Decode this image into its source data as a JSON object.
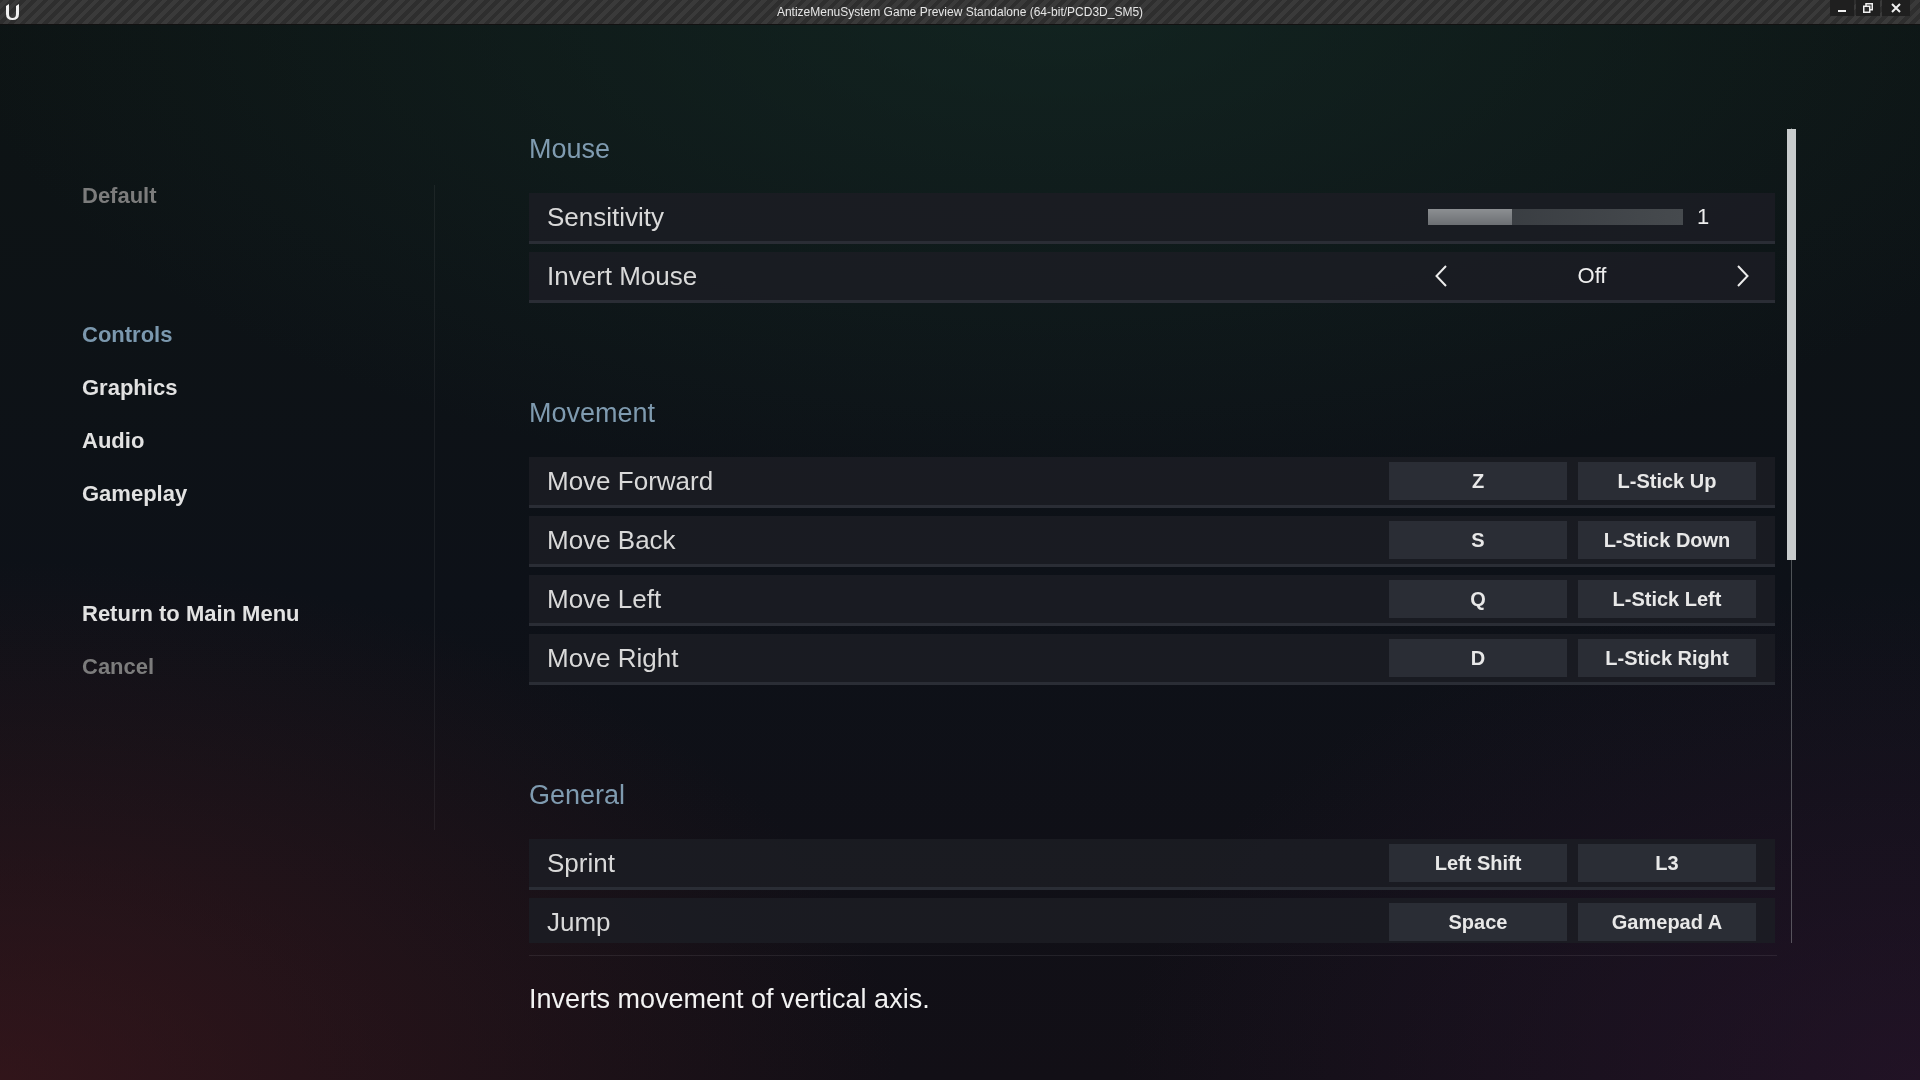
{
  "window": {
    "title": "AntizeMenuSystem Game Preview Standalone (64-bit/PCD3D_SM5)"
  },
  "sidebar": {
    "top_items": [
      {
        "label": "Default",
        "disabled": true
      }
    ],
    "tabs": [
      {
        "label": "Controls",
        "selected": true
      },
      {
        "label": "Graphics",
        "selected": false
      },
      {
        "label": "Audio",
        "selected": false
      },
      {
        "label": "Gameplay",
        "selected": false
      }
    ],
    "actions": [
      {
        "label": "Return to Main Menu",
        "disabled": false
      },
      {
        "label": "Cancel",
        "disabled": true
      }
    ]
  },
  "sections": [
    {
      "title": "Mouse",
      "rows": [
        {
          "kind": "slider",
          "label": "Sensitivity",
          "level": 0.33,
          "reading": "1"
        },
        {
          "kind": "selector",
          "label": "Invert Mouse",
          "value": "Off"
        }
      ]
    },
    {
      "title": "Movement",
      "rows": [
        {
          "kind": "binding",
          "label": "Move Forward",
          "keys": [
            "Z",
            "L-Stick Up"
          ]
        },
        {
          "kind": "binding",
          "label": "Move Back",
          "keys": [
            "S",
            "L-Stick Down"
          ]
        },
        {
          "kind": "binding",
          "label": "Move Left",
          "keys": [
            "Q",
            "L-Stick Left"
          ]
        },
        {
          "kind": "binding",
          "label": "Move Right",
          "keys": [
            "D",
            "L-Stick Right"
          ]
        }
      ]
    },
    {
      "title": "General",
      "rows": [
        {
          "kind": "binding",
          "label": "Sprint",
          "keys": [
            "Left Shift",
            "L3"
          ]
        },
        {
          "kind": "binding",
          "label": "Jump",
          "keys": [
            "Space",
            "Gamepad A"
          ]
        }
      ]
    }
  ],
  "description": "Inverts movement of vertical axis."
}
